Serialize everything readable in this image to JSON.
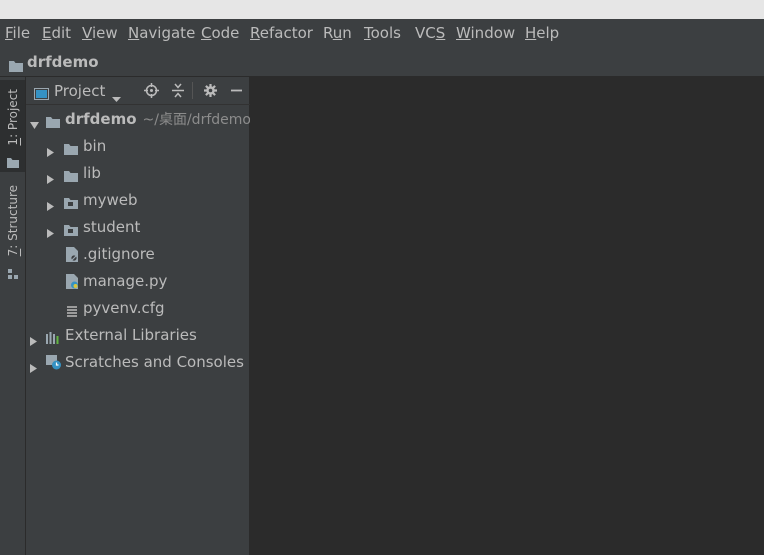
{
  "menu": {
    "file": {
      "m": "F",
      "r": "ile"
    },
    "edit": {
      "m": "E",
      "r": "dit"
    },
    "view": {
      "m": "V",
      "r": "iew"
    },
    "navigate": {
      "m": "N",
      "r": "avigate"
    },
    "code": {
      "m": "C",
      "r": "ode"
    },
    "refactor": {
      "m": "R",
      "r": "efactor"
    },
    "run": {
      "l": "R",
      "m": "u",
      "r": "n"
    },
    "tools": {
      "m": "T",
      "r": "ools"
    },
    "vcs": {
      "l": "VC",
      "m": "S"
    },
    "window": {
      "m": "W",
      "r": "indow"
    },
    "help": {
      "m": "H",
      "r": "elp"
    }
  },
  "navbar": {
    "title": "drfdemo",
    "icon": "folder-icon"
  },
  "side_tabs": {
    "project": {
      "num": "1",
      "label": ": Project"
    },
    "structure": {
      "num": "7",
      "label": ": Structure"
    }
  },
  "panel": {
    "title": "Project",
    "icons": [
      "locate-icon",
      "collapse-all-icon",
      "gear-icon",
      "minimize-icon"
    ]
  },
  "tree": {
    "root": {
      "label": "drfdemo",
      "path": "~/桌面/drfdemo"
    },
    "items": [
      {
        "label": "bin",
        "icon": "folder-icon"
      },
      {
        "label": "lib",
        "icon": "folder-icon"
      },
      {
        "label": "myweb",
        "icon": "package-folder-icon"
      },
      {
        "label": "student",
        "icon": "package-folder-icon"
      },
      {
        "label": ".gitignore",
        "icon": "ignore-file-icon"
      },
      {
        "label": "manage.py",
        "icon": "python-file-icon"
      },
      {
        "label": "pyvenv.cfg",
        "icon": "config-file-icon"
      },
      {
        "label": "External Libraries",
        "icon": "libraries-icon"
      },
      {
        "label": "Scratches and Consoles",
        "icon": "scratches-icon"
      }
    ]
  },
  "colors": {
    "background": "#2b2b2b",
    "panel": "#3c3f41",
    "text": "#bbbbbb",
    "hint": "#8c8c8c",
    "accent": "#3592c4"
  }
}
